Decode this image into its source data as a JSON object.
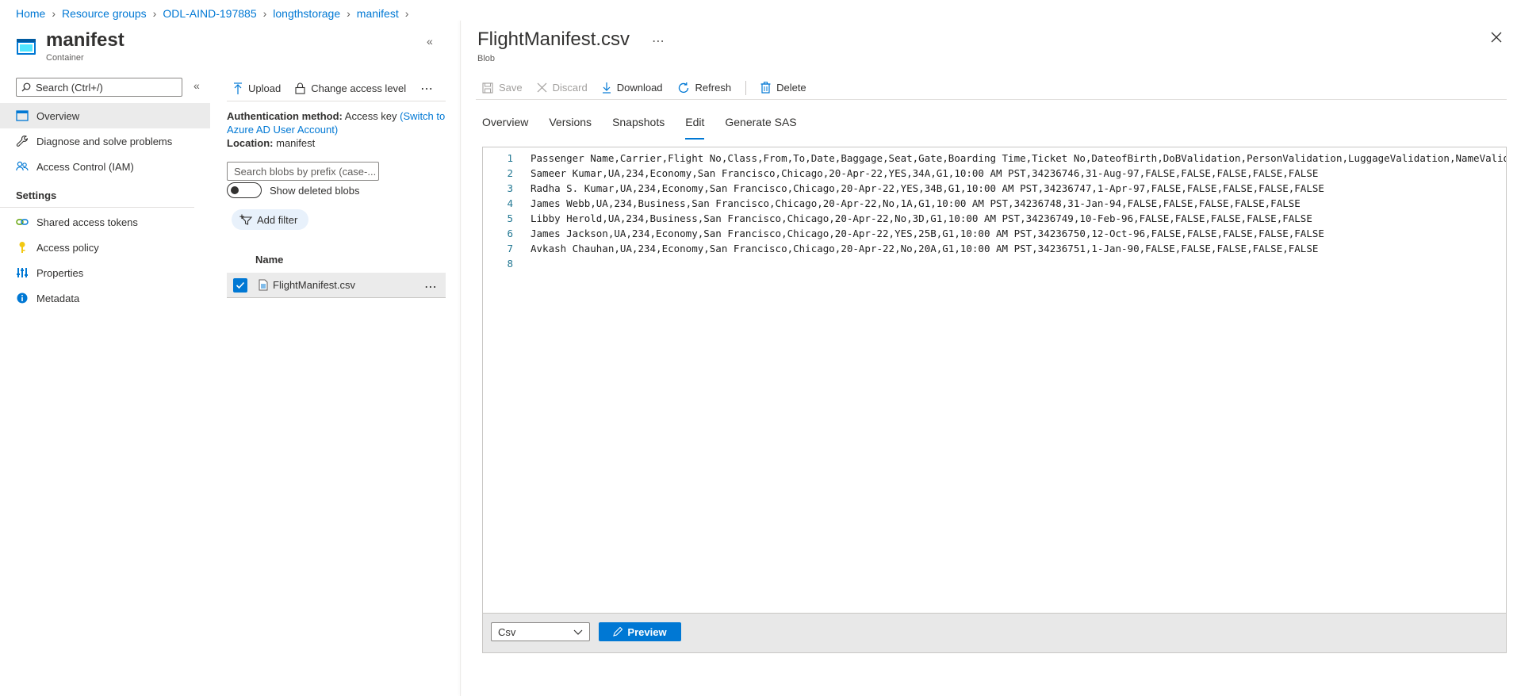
{
  "breadcrumb": [
    {
      "label": "Home"
    },
    {
      "label": "Resource groups"
    },
    {
      "label": "ODL-AIND-197885"
    },
    {
      "label": "longthstorage"
    },
    {
      "label": "manifest"
    }
  ],
  "left_blade": {
    "title": "manifest",
    "subtitle": "Container",
    "search_placeholder": "Search (Ctrl+/)",
    "nav_items": [
      {
        "label": "Overview",
        "active": true
      },
      {
        "label": "Diagnose and solve problems"
      },
      {
        "label": "Access Control (IAM)"
      }
    ],
    "settings_header": "Settings",
    "settings_items": [
      {
        "label": "Shared access tokens"
      },
      {
        "label": "Access policy"
      },
      {
        "label": "Properties"
      },
      {
        "label": "Metadata"
      }
    ]
  },
  "middle_pane": {
    "toolbar": {
      "upload": "Upload",
      "change_access": "Change access level"
    },
    "auth_label": "Authentication method:",
    "auth_value": "Access key",
    "auth_link": "(Switch to Azure AD User Account)",
    "location_label": "Location:",
    "location_value": "manifest",
    "blob_search_placeholder": "Search blobs by prefix (case-...",
    "show_deleted": "Show deleted blobs",
    "add_filter": "Add filter",
    "column_name": "Name",
    "files": [
      {
        "name": "FlightManifest.csv",
        "checked": true
      }
    ]
  },
  "right_blade": {
    "title": "FlightManifest.csv",
    "subtitle": "Blob",
    "toolbar": {
      "save": "Save",
      "discard": "Discard",
      "download": "Download",
      "refresh": "Refresh",
      "delete": "Delete"
    },
    "tabs": [
      {
        "label": "Overview"
      },
      {
        "label": "Versions"
      },
      {
        "label": "Snapshots"
      },
      {
        "label": "Edit",
        "active": true
      },
      {
        "label": "Generate SAS"
      }
    ],
    "editor_lines": [
      {
        "n": "1",
        "text": "Passenger Name,Carrier,Flight No,Class,From,To,Date,Baggage,Seat,Gate,Boarding Time,Ticket No,DateofBirth,DoBValidation,PersonValidation,LuggageValidation,NameValidation,BoardingPassValidation"
      },
      {
        "n": "2",
        "text": "Sameer Kumar,UA,234,Economy,San Francisco,Chicago,20-Apr-22,YES,34A,G1,10:00 AM PST,34236746,31-Aug-97,FALSE,FALSE,FALSE,FALSE,FALSE"
      },
      {
        "n": "3",
        "text": "Radha S. Kumar,UA,234,Economy,San Francisco,Chicago,20-Apr-22,YES,34B,G1,10:00 AM PST,34236747,1-Apr-97,FALSE,FALSE,FALSE,FALSE,FALSE"
      },
      {
        "n": "4",
        "text": "James Webb,UA,234,Business,San Francisco,Chicago,20-Apr-22,No,1A,G1,10:00 AM PST,34236748,31-Jan-94,FALSE,FALSE,FALSE,FALSE,FALSE"
      },
      {
        "n": "5",
        "text": "Libby Herold,UA,234,Business,San Francisco,Chicago,20-Apr-22,No,3D,G1,10:00 AM PST,34236749,10-Feb-96,FALSE,FALSE,FALSE,FALSE,FALSE"
      },
      {
        "n": "6",
        "text": "James Jackson,UA,234,Economy,San Francisco,Chicago,20-Apr-22,YES,25B,G1,10:00 AM PST,34236750,12-Oct-96,FALSE,FALSE,FALSE,FALSE,FALSE"
      },
      {
        "n": "7",
        "text": "Avkash Chauhan,UA,234,Economy,San Francisco,Chicago,20-Apr-22,No,20A,G1,10:00 AM PST,34236751,1-Jan-90,FALSE,FALSE,FALSE,FALSE,FALSE"
      },
      {
        "n": "8",
        "text": ""
      }
    ],
    "language": "Csv",
    "preview": "Preview"
  },
  "colors": {
    "accent": "#0078d4",
    "selected_bg": "#ebebeb",
    "footer_bg": "#e8e8e8"
  }
}
